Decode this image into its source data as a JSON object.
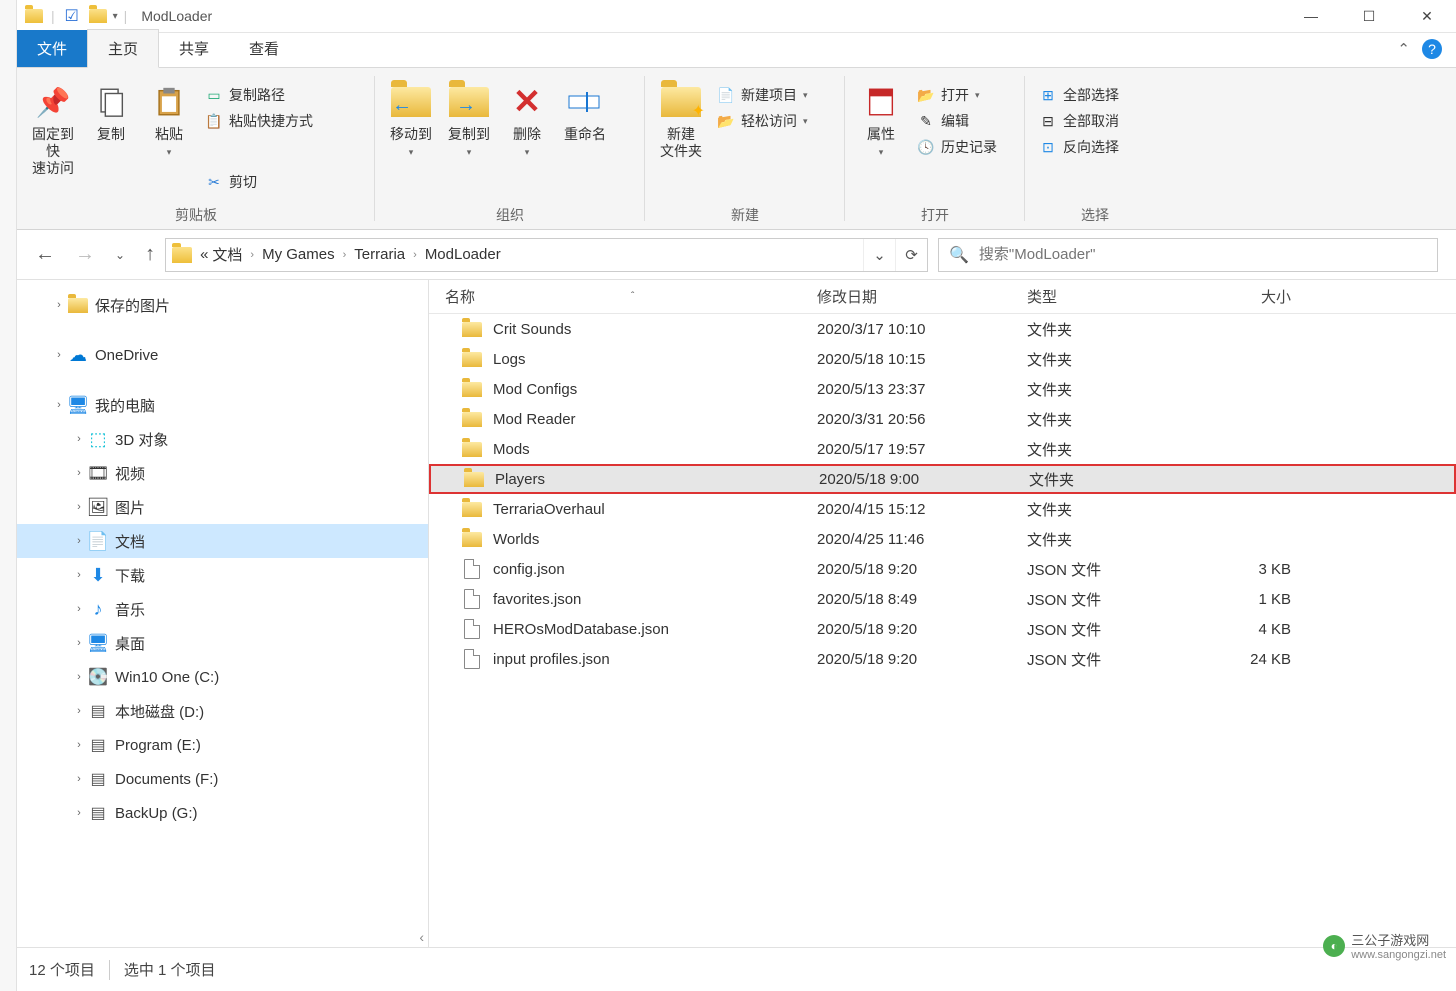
{
  "title": "ModLoader",
  "tabs": {
    "file": "文件",
    "home": "主页",
    "share": "共享",
    "view": "查看"
  },
  "ribbon": {
    "clipboard": {
      "pin": "固定到快\n速访问",
      "copy": "复制",
      "paste": "粘贴",
      "copy_path": "复制路径",
      "paste_shortcut": "粘贴快捷方式",
      "cut": "剪切",
      "label": "剪贴板"
    },
    "organize": {
      "move_to": "移动到",
      "copy_to": "复制到",
      "delete": "删除",
      "rename": "重命名",
      "label": "组织"
    },
    "new": {
      "new_folder": "新建\n文件夹",
      "new_item": "新建项目",
      "easy_access": "轻松访问",
      "label": "新建"
    },
    "open": {
      "properties": "属性",
      "open": "打开",
      "edit": "编辑",
      "history": "历史记录",
      "label": "打开"
    },
    "select": {
      "select_all": "全部选择",
      "select_none": "全部取消",
      "invert": "反向选择",
      "label": "选择"
    }
  },
  "breadcrumb": {
    "prefix": "«",
    "items": [
      "文档",
      "My Games",
      "Terraria",
      "ModLoader"
    ]
  },
  "search": {
    "placeholder": "搜索\"ModLoader\""
  },
  "nav_tree": [
    {
      "label": "保存的图片",
      "indent": 34,
      "icon": "folder"
    },
    {
      "label": "OneDrive",
      "indent": 34,
      "icon": "onedrive",
      "gap_before": true
    },
    {
      "label": "我的电脑",
      "indent": 34,
      "icon": "pc",
      "gap_before": true
    },
    {
      "label": "3D 对象",
      "indent": 54,
      "icon": "3d"
    },
    {
      "label": "视频",
      "indent": 54,
      "icon": "video"
    },
    {
      "label": "图片",
      "indent": 54,
      "icon": "pictures"
    },
    {
      "label": "文档",
      "indent": 54,
      "icon": "documents",
      "selected": true
    },
    {
      "label": "下载",
      "indent": 54,
      "icon": "downloads"
    },
    {
      "label": "音乐",
      "indent": 54,
      "icon": "music"
    },
    {
      "label": "桌面",
      "indent": 54,
      "icon": "desktop"
    },
    {
      "label": "Win10 One (C:)",
      "indent": 54,
      "icon": "drive-c"
    },
    {
      "label": "本地磁盘 (D:)",
      "indent": 54,
      "icon": "drive"
    },
    {
      "label": "Program (E:)",
      "indent": 54,
      "icon": "drive"
    },
    {
      "label": "Documents (F:)",
      "indent": 54,
      "icon": "drive"
    },
    {
      "label": "BackUp (G:)",
      "indent": 54,
      "icon": "drive"
    }
  ],
  "columns": {
    "name": "名称",
    "date": "修改日期",
    "type": "类型",
    "size": "大小"
  },
  "files": [
    {
      "name": "Crit Sounds",
      "date": "2020/3/17 10:10",
      "type": "文件夹",
      "size": "",
      "icon": "folder"
    },
    {
      "name": "Logs",
      "date": "2020/5/18 10:15",
      "type": "文件夹",
      "size": "",
      "icon": "folder"
    },
    {
      "name": "Mod Configs",
      "date": "2020/5/13 23:37",
      "type": "文件夹",
      "size": "",
      "icon": "folder"
    },
    {
      "name": "Mod Reader",
      "date": "2020/3/31 20:56",
      "type": "文件夹",
      "size": "",
      "icon": "folder"
    },
    {
      "name": "Mods",
      "date": "2020/5/17 19:57",
      "type": "文件夹",
      "size": "",
      "icon": "folder"
    },
    {
      "name": "Players",
      "date": "2020/5/18 9:00",
      "type": "文件夹",
      "size": "",
      "icon": "folder",
      "highlighted": true
    },
    {
      "name": "TerrariaOverhaul",
      "date": "2020/4/15 15:12",
      "type": "文件夹",
      "size": "",
      "icon": "folder"
    },
    {
      "name": "Worlds",
      "date": "2020/4/25 11:46",
      "type": "文件夹",
      "size": "",
      "icon": "folder"
    },
    {
      "name": "config.json",
      "date": "2020/5/18 9:20",
      "type": "JSON 文件",
      "size": "3 KB",
      "icon": "file"
    },
    {
      "name": "favorites.json",
      "date": "2020/5/18 8:49",
      "type": "JSON 文件",
      "size": "1 KB",
      "icon": "file"
    },
    {
      "name": "HEROsModDatabase.json",
      "date": "2020/5/18 9:20",
      "type": "JSON 文件",
      "size": "4 KB",
      "icon": "file"
    },
    {
      "name": "input profiles.json",
      "date": "2020/5/18 9:20",
      "type": "JSON 文件",
      "size": "24 KB",
      "icon": "file"
    }
  ],
  "status": {
    "count": "12 个项目",
    "selected": "选中 1 个项目"
  },
  "watermark": {
    "text": "三公子游戏网",
    "sub": "www.sangongzi.net"
  }
}
